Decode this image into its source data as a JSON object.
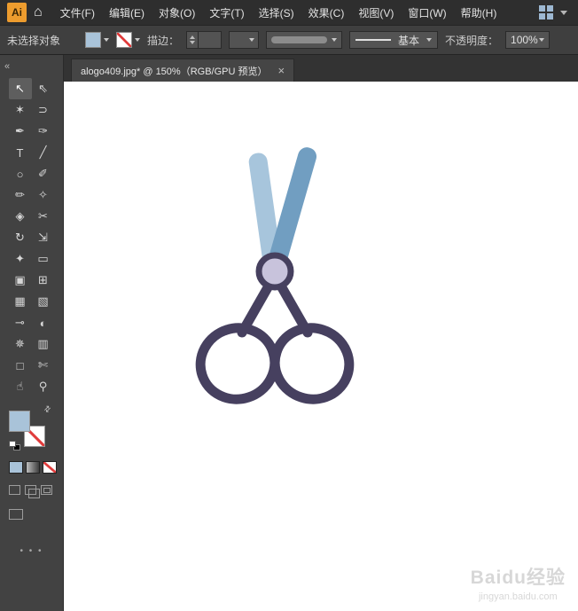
{
  "menu_bar": {
    "logo_text": "Ai",
    "home_glyph": "⌂",
    "items": [
      {
        "key": "file",
        "label": "文件(F)"
      },
      {
        "key": "edit",
        "label": "编辑(E)"
      },
      {
        "key": "object",
        "label": "对象(O)"
      },
      {
        "key": "type",
        "label": "文字(T)"
      },
      {
        "key": "select",
        "label": "选择(S)"
      },
      {
        "key": "effect",
        "label": "效果(C)"
      },
      {
        "key": "view",
        "label": "视图(V)"
      },
      {
        "key": "window",
        "label": "窗口(W)"
      },
      {
        "key": "help",
        "label": "帮助(H)"
      }
    ]
  },
  "control_bar": {
    "status_text": "未选择对象",
    "stroke_label": "描边：",
    "brush_name": "基本",
    "opacity_label": "不透明度：",
    "opacity_value": "100%"
  },
  "document": {
    "tab_title": "alogo409.jpg* @ 150%（RGB/GPU 预览）",
    "close_glyph": "×"
  },
  "toolbar": {
    "collapse_glyph": "«",
    "swap_glyph": "⇄",
    "more_glyph": "• • •",
    "tools": [
      {
        "key": "selection-tool",
        "glyph": "↖",
        "active": true
      },
      {
        "key": "direct-selection-tool",
        "glyph": "⇖"
      },
      {
        "key": "magic-wand-tool",
        "glyph": "✶"
      },
      {
        "key": "lasso-tool",
        "glyph": "⊃"
      },
      {
        "key": "pen-tool",
        "glyph": "✒"
      },
      {
        "key": "curvature-tool",
        "glyph": "✑"
      },
      {
        "key": "type-tool",
        "glyph": "T"
      },
      {
        "key": "line-segment-tool",
        "glyph": "╱"
      },
      {
        "key": "ellipse-tool",
        "glyph": "○"
      },
      {
        "key": "paintbrush-tool",
        "glyph": "✐"
      },
      {
        "key": "pencil-tool",
        "glyph": "✏"
      },
      {
        "key": "shaper-tool",
        "glyph": "✧"
      },
      {
        "key": "eraser-tool",
        "glyph": "◈"
      },
      {
        "key": "scissors-tool",
        "glyph": "✂"
      },
      {
        "key": "rotate-tool",
        "glyph": "↻"
      },
      {
        "key": "scale-tool",
        "glyph": "⇲"
      },
      {
        "key": "width-tool",
        "glyph": "✦"
      },
      {
        "key": "free-transform-tool",
        "glyph": "▭"
      },
      {
        "key": "shape-builder-tool",
        "glyph": "▣"
      },
      {
        "key": "perspective-grid-tool",
        "glyph": "⊞"
      },
      {
        "key": "mesh-tool",
        "glyph": "▦"
      },
      {
        "key": "gradient-tool",
        "glyph": "▧"
      },
      {
        "key": "eyedropper-tool",
        "glyph": "⊸"
      },
      {
        "key": "blend-tool",
        "glyph": "◐"
      },
      {
        "key": "symbol-sprayer-tool",
        "glyph": "✵"
      },
      {
        "key": "column-graph-tool",
        "glyph": "▥"
      },
      {
        "key": "artboard-tool",
        "glyph": "□"
      },
      {
        "key": "slice-tool",
        "glyph": "✄"
      },
      {
        "key": "hand-tool",
        "glyph": "☝"
      },
      {
        "key": "zoom-tool",
        "glyph": "⚲"
      }
    ]
  },
  "canvas": {
    "watermark_line1": "Baidu经验",
    "watermark_line2": "jingyan.baidu.com"
  },
  "colors": {
    "logo_bg": "#ED9C2E",
    "fill_swatch": "#A9C3D9",
    "blade_left": "#A7C5DC",
    "blade_right": "#719EC1",
    "pivot_fill": "#C8C3DC",
    "handle_stroke": "#46405F"
  }
}
